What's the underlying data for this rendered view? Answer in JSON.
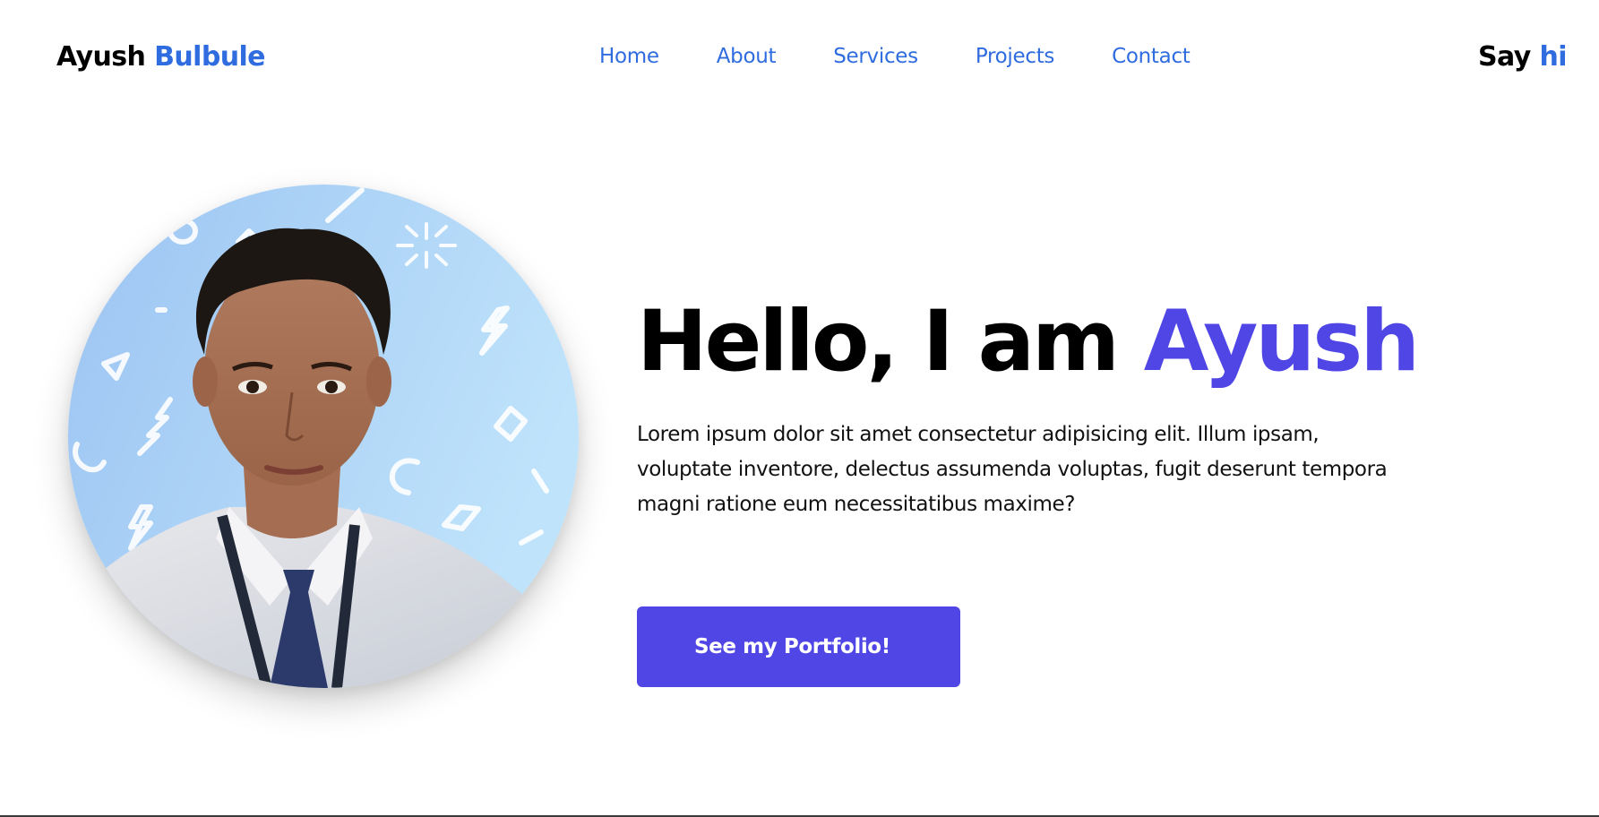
{
  "header": {
    "logo_first": "Ayush",
    "logo_last": "Bulbule",
    "nav": [
      "Home",
      "About",
      "Services",
      "Projects",
      "Contact"
    ],
    "cta_word1": "Say",
    "cta_word2": "hi"
  },
  "hero": {
    "title_prefix": "Hello, I am",
    "title_name": "Ayush",
    "description": "Lorem ipsum dolor sit amet consectetur adipisicing elit. Illum ipsam, voluptate inventore, delectus assumenda voluptas, fugit deserunt tempora magni ratione eum necessitatibus maxime?",
    "button_label": "See my Portfolio!",
    "photo": "profile-photo"
  },
  "colors": {
    "accent_blue": "#2f6ce0",
    "accent_indigo": "#4f46e5",
    "photo_background": "#a9d0f5"
  }
}
